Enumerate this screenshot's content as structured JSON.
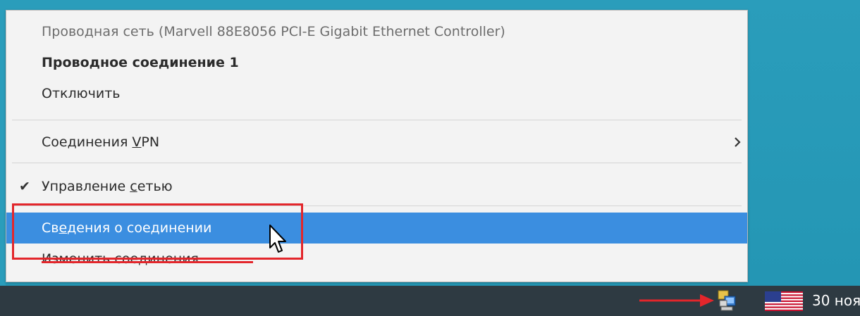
{
  "menu": {
    "header_device": "Проводная сеть (Marvell 88E8056 PCI-E Gigabit Ethernet Controller)",
    "connection_name": "Проводное соединение 1",
    "disconnect_label": "Отключить",
    "vpn": {
      "before": "Соединения ",
      "accel": "V",
      "after": "PN"
    },
    "manage": {
      "checked_glyph": "✔",
      "before": "Управление ",
      "accel": "с",
      "after": "етью"
    },
    "connection_info": {
      "before": "Св",
      "accel": "е",
      "after": "дения о соединении"
    },
    "edit_connections_label": "Изменить соединения..."
  },
  "taskbar": {
    "clock_text": "30 ноя",
    "network_icon": "network-wired-icon",
    "flag_icon": "us-flag-icon"
  },
  "colors": {
    "highlight": "#3b8ee0",
    "annotation_red": "#e3262b",
    "desktop": "#2a9dbb",
    "taskbar": "#2e3a42"
  }
}
